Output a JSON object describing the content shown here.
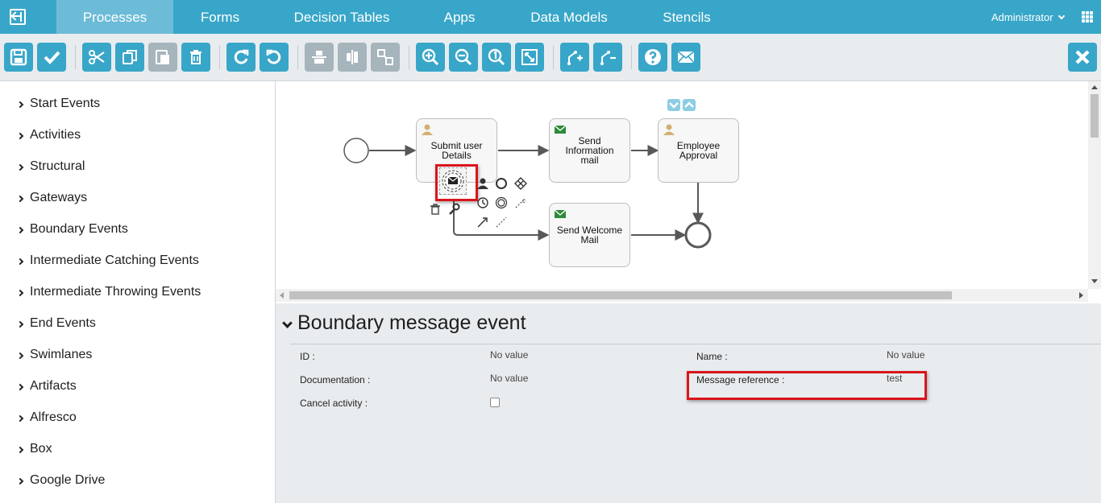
{
  "nav": {
    "tabs": [
      "Processes",
      "Forms",
      "Decision Tables",
      "Apps",
      "Data Models",
      "Stencils"
    ],
    "active_tab": "Processes",
    "user": "Administrator"
  },
  "palette": {
    "items": [
      "Start Events",
      "Activities",
      "Structural",
      "Gateways",
      "Boundary Events",
      "Intermediate Catching Events",
      "Intermediate Throwing Events",
      "End Events",
      "Swimlanes",
      "Artifacts",
      "Alfresco",
      "Box",
      "Google Drive"
    ]
  },
  "diagram": {
    "tasks": {
      "submit": "Submit user\nDetails",
      "send_info": "Send\nInformation\nmail",
      "approval": "Employee\nApproval",
      "welcome": "Send Welcome\nMail"
    }
  },
  "properties": {
    "title": "Boundary message event",
    "fields": {
      "id_label": "ID :",
      "id_value": "No value",
      "doc_label": "Documentation :",
      "doc_value": "No value",
      "cancel_label": "Cancel activity :",
      "name_label": "Name :",
      "name_value": "No value",
      "msgref_label": "Message reference :",
      "msgref_value": "test"
    },
    "cancel_activity_checked": false
  },
  "colors": {
    "accent": "#38a6c8",
    "highlight": "#d9151b"
  }
}
